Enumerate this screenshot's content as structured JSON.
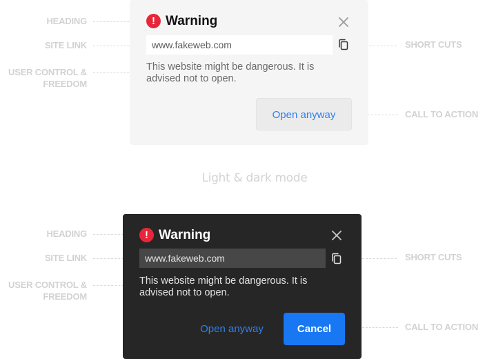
{
  "annotations": {
    "heading": "HEADING",
    "site_link": "SITE LINK",
    "user_control": [
      "USER CONTROL &",
      "FREEDOM"
    ],
    "shortcuts": "SHORT CUTS",
    "call_to_action": "CALL TO ACTION"
  },
  "mode_caption": "Light & dark mode",
  "light_dialog": {
    "icon": "exclamation-icon",
    "title": "Warning",
    "url": "www.fakeweb.com",
    "message": "This website might be dangerous. It is advised not to open.",
    "open_label": "Open anyway"
  },
  "dark_dialog": {
    "icon": "exclamation-icon",
    "title": "Warning",
    "url": "www.fakeweb.com",
    "message": "This website might be dangerous. It is advised not to open.",
    "open_label": "Open anyway",
    "cancel_label": "Cancel"
  },
  "colors": {
    "alert_red": "#e6273b",
    "link_blue": "#2f80ed",
    "primary_blue": "#1877f2",
    "light_bg": "#f5f5f5",
    "dark_bg": "#262626"
  }
}
